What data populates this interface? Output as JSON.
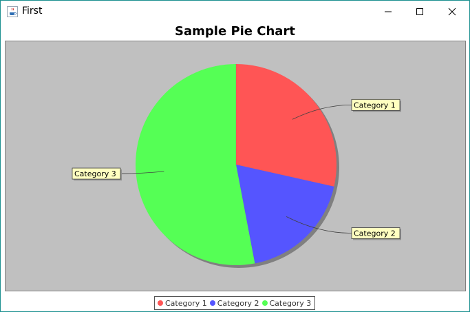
{
  "window": {
    "title": "First",
    "icon": "java-cup-icon"
  },
  "controls": {
    "minimize_icon": "minimize-icon",
    "maximize_icon": "maximize-icon",
    "close_icon": "close-icon"
  },
  "chart_data": {
    "type": "pie",
    "title": "Sample Pie Chart",
    "categories": [
      "Category 1",
      "Category 2",
      "Category 3"
    ],
    "values": [
      28.5,
      18.5,
      53.0
    ],
    "colors": [
      "#ff5555",
      "#5555ff",
      "#55ff55"
    ],
    "legend": "bottom",
    "background": "#c0c0c0"
  }
}
